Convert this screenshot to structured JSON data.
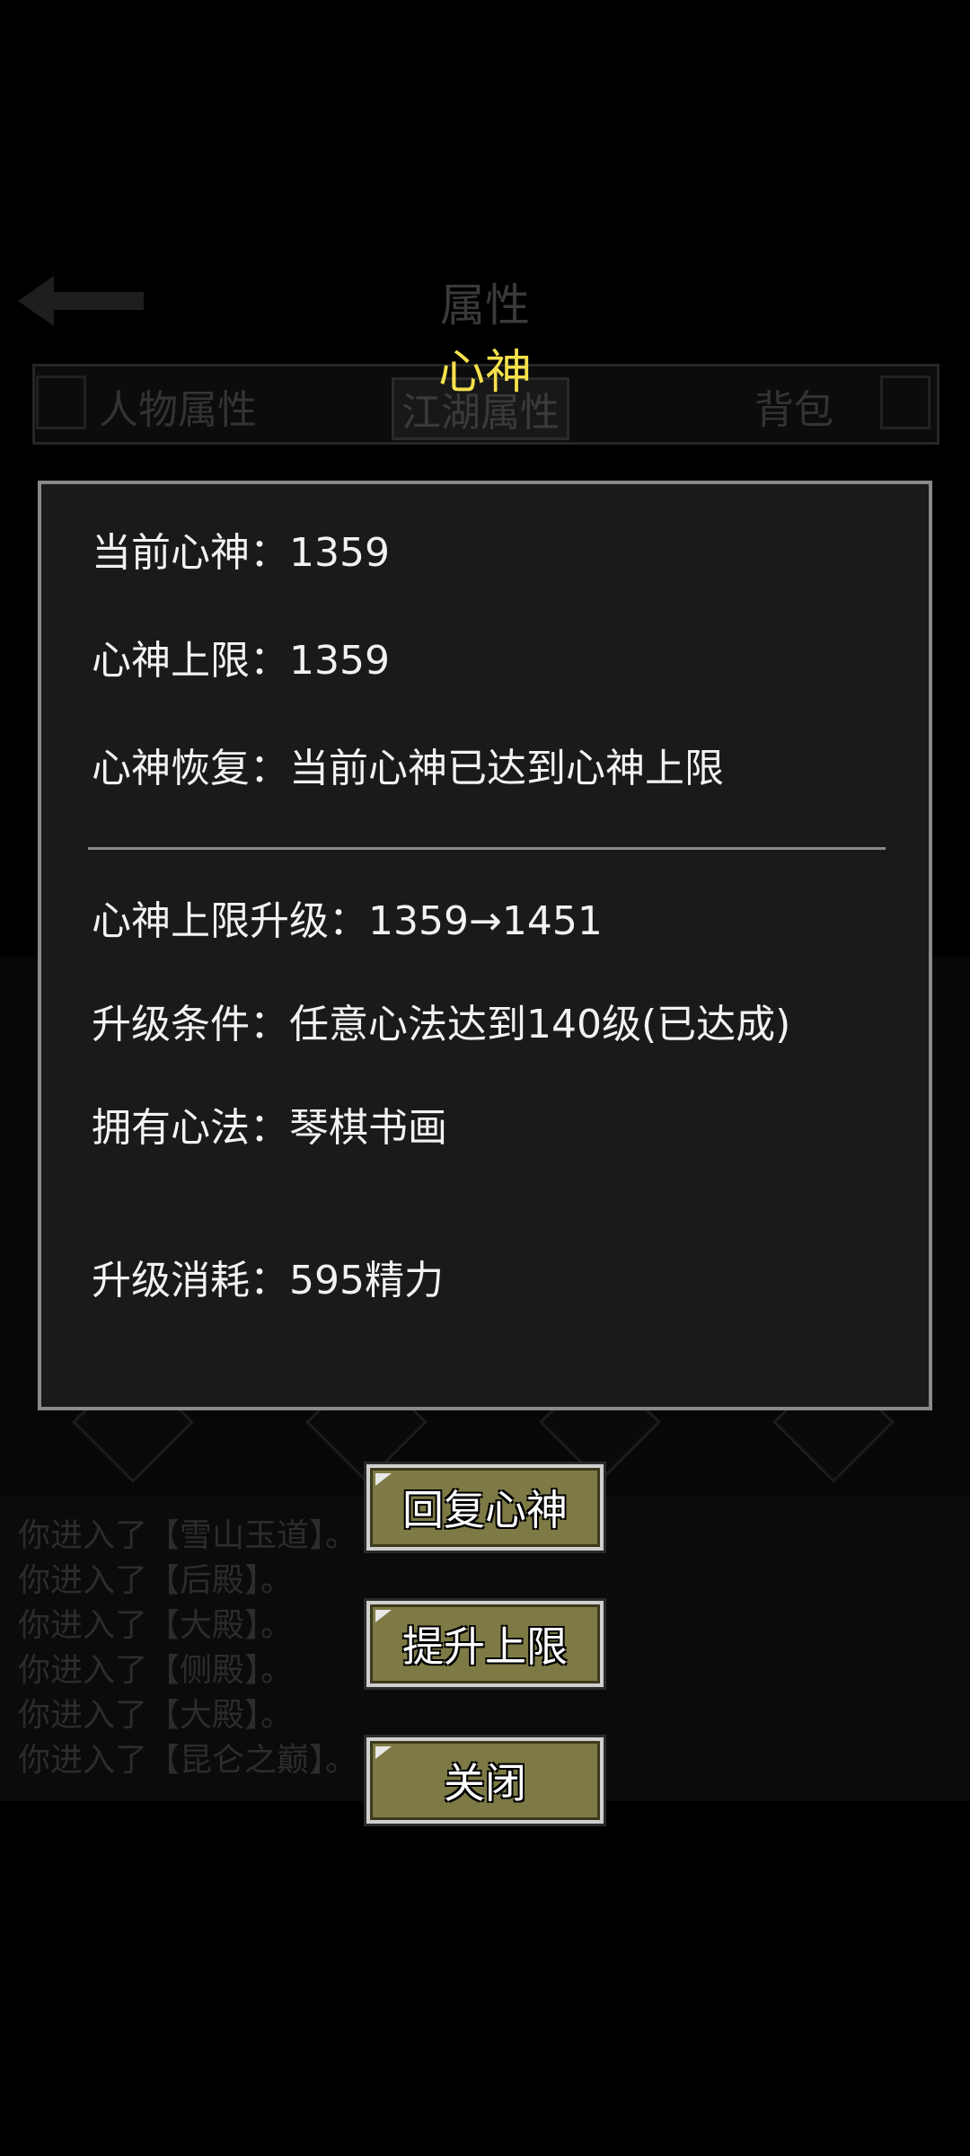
{
  "background": {
    "title": "属性",
    "tabs": [
      "人物属性",
      "江湖属性",
      "背包"
    ],
    "active_tab": "江湖属性",
    "log": [
      "你进入了【雪山玉道】。",
      "你进入了【后殿】。",
      "你进入了【大殿】。",
      "你进入了【侧殿】。",
      "你进入了【大殿】。",
      "你进入了【昆仑之巅】。"
    ]
  },
  "dialog": {
    "title": "心神",
    "current_label": "当前心神：",
    "current_value": "1359",
    "limit_label": "心神上限：",
    "limit_value": "1359",
    "recover_label": "心神恢复：",
    "recover_value": "当前心神已达到心神上限",
    "upgrade_label": "心神上限升级：",
    "upgrade_value": "1359→1451",
    "condition_label": "升级条件：",
    "condition_value": "任意心法达到140级(已达成)",
    "own_label": "拥有心法：",
    "own_value": "琴棋书画",
    "cost_label": "升级消耗：",
    "cost_value": "595精力"
  },
  "buttons": {
    "recover": "回复心神",
    "raise": "提升上限",
    "close": "关闭"
  },
  "colors": {
    "title": "#f5e14c",
    "button_bg": "#7d7a45",
    "panel_bg": "#1a1a1a"
  }
}
